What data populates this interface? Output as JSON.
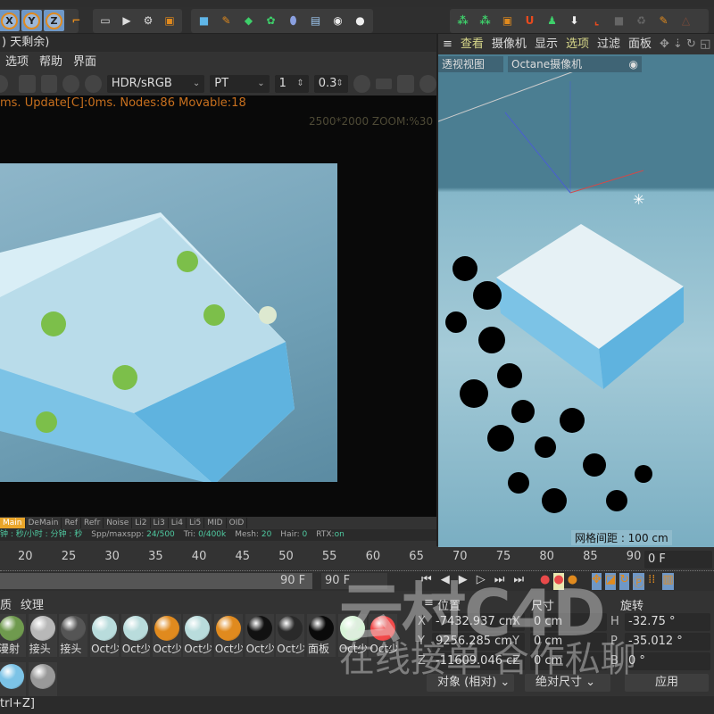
{
  "toolbar": {
    "axes": [
      "X",
      "Y",
      "Z"
    ]
  },
  "octane": {
    "title_fragment": ") 天剩余)",
    "menu": [
      "选项",
      "帮助",
      "界面"
    ],
    "color_mode": "HDR/sRGB",
    "kernel": "PT",
    "value1": "1",
    "value2": "0.3",
    "status": "ms. Update[C]:0ms. Nodes:86 Movable:18",
    "resolution": "2500*2000 ZOOM:%30",
    "passes": [
      "Main",
      "DeMain",
      "Ref",
      "Refr",
      "Noise",
      "Li2",
      "Li3",
      "Li4",
      "Li5",
      "MID",
      "OID"
    ],
    "stats": {
      "time": "钟 : 秒/小时 : 分钟 : 秒",
      "spp_label": "Spp/maxspp:",
      "spp": "24/500",
      "tri_label": "Tri:",
      "tri": "0/400k",
      "mesh_label": "Mesh:",
      "mesh": "20",
      "hair_label": "Hair:",
      "hair": "0",
      "rtx_label": "RTX:",
      "rtx": "on"
    }
  },
  "viewport": {
    "menu": [
      "查看",
      "摄像机",
      "显示",
      "选项",
      "过滤",
      "面板"
    ],
    "view_name": "透视视图",
    "camera": "Octane摄像机",
    "grid": "网格间距 : 100 cm"
  },
  "timeline": {
    "ticks": [
      "20",
      "25",
      "30",
      "35",
      "40",
      "45",
      "50",
      "55",
      "60",
      "65",
      "70",
      "75",
      "80",
      "85",
      "90"
    ],
    "end_frame": "90 F",
    "end_frame2": "90 F",
    "current": "0 F"
  },
  "materials": {
    "tabs": [
      "质",
      "纹理"
    ],
    "items": [
      {
        "label": "漫射",
        "color": "#6f9a4e"
      },
      {
        "label": "接头",
        "color": "#b8b8b8"
      },
      {
        "label": "接头",
        "color": "#555"
      },
      {
        "label": "Oct少",
        "color": "#b9dcdc"
      },
      {
        "label": "Oct少",
        "color": "#b9dcdc"
      },
      {
        "label": "Oct少",
        "color": "#e08a1e"
      },
      {
        "label": "Oct少",
        "color": "#b9dcdc"
      },
      {
        "label": "Oct少",
        "color": "#e08a1e"
      },
      {
        "label": "Oct少",
        "color": "#111"
      },
      {
        "label": "Oct少",
        "color": "#2a2a2a"
      },
      {
        "label": "面板",
        "color": "#0a0a0a"
      },
      {
        "label": "Oct少",
        "color": "#d6f3d6"
      },
      {
        "label": "Oct少",
        "color": "#f24a4a"
      },
      {
        "label": "",
        "color": "#7cc3e6"
      },
      {
        "label": "",
        "color": "#999"
      }
    ]
  },
  "coords": {
    "headers": [
      "位置",
      "尺寸",
      "旋转"
    ],
    "pos": [
      {
        "axis": "X",
        "value": "-7432.937 cm"
      },
      {
        "axis": "Y",
        "value": "9256.285 cm"
      },
      {
        "axis": "Z",
        "value": "-11609.046 cr"
      }
    ],
    "size": [
      {
        "axis": "X",
        "value": "0 cm"
      },
      {
        "axis": "Y",
        "value": "0 cm"
      },
      {
        "axis": "Z",
        "value": "0 cm"
      }
    ],
    "rot": [
      {
        "axis": "H",
        "value": "-32.75 °"
      },
      {
        "axis": "P",
        "value": "-35.012 °"
      },
      {
        "axis": "B",
        "value": "0 °"
      }
    ],
    "mode": "对象 (相对)",
    "size_mode": "绝对尺寸",
    "apply": "应用"
  },
  "status_bar": "trl+Z]",
  "watermark": {
    "logo": "云村C4D",
    "slogan": "在线接单 合作私聊"
  }
}
